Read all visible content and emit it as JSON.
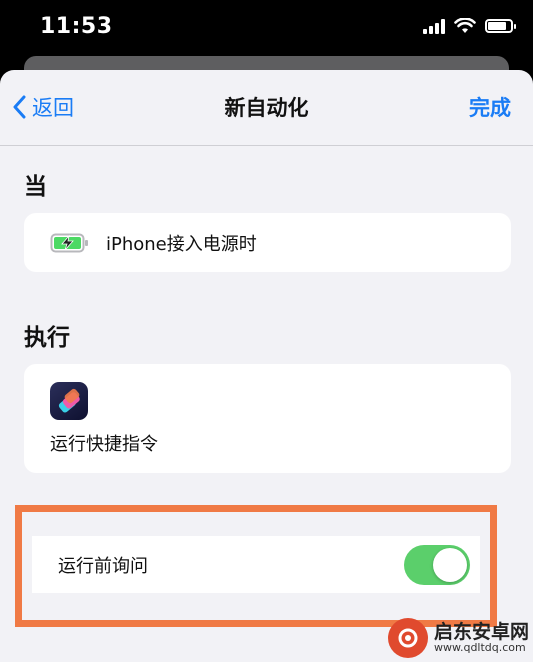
{
  "status_bar": {
    "time": "11:53",
    "icons": [
      "signal-icon",
      "wifi-icon",
      "battery-icon"
    ]
  },
  "nav": {
    "back_label": "返回",
    "title": "新自动化",
    "done_label": "完成"
  },
  "when_section": {
    "header": "当",
    "trigger": {
      "icon": "battery-charging-icon",
      "label": "iPhone接入电源时"
    }
  },
  "do_section": {
    "header": "执行",
    "action": {
      "icon": "shortcuts-app-icon",
      "label": "运行快捷指令"
    }
  },
  "ask_before_running": {
    "label": "运行前询问",
    "enabled": true
  },
  "watermark": {
    "title": "启东安卓网",
    "url": "www.qdltdq.com"
  },
  "colors": {
    "accent": "#1a7cf5",
    "toggle_on": "#5bcf6b",
    "highlight": "#f07a45",
    "battery_green": "#4cd964"
  }
}
